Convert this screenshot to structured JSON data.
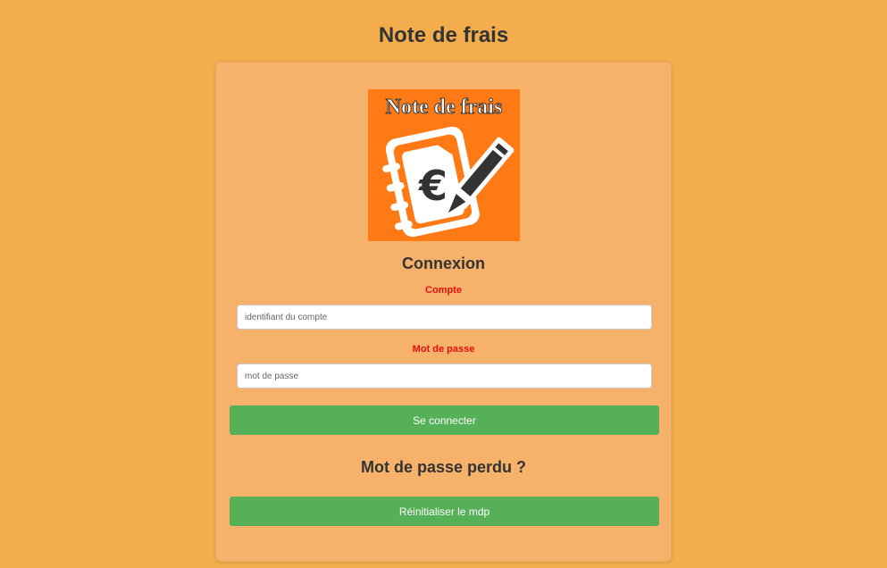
{
  "page": {
    "title": "Note de frais"
  },
  "logo": {
    "text": "Note de frais",
    "icon": "notebook-euro-pencil-icon",
    "background_color": "#ff7a14"
  },
  "login": {
    "heading": "Connexion",
    "account_label": "Compte",
    "account_placeholder": "identifiant du compte",
    "password_label": "Mot de passe",
    "password_placeholder": "mot de passe",
    "submit_label": "Se connecter"
  },
  "recovery": {
    "heading": "Mot de passe perdu ?",
    "reset_label": "Réinitialiser le mdp"
  },
  "colors": {
    "page_background": "#f4ad4c",
    "card_background": "#f6b26b",
    "button_green": "#55b058",
    "label_red": "#e01010"
  }
}
